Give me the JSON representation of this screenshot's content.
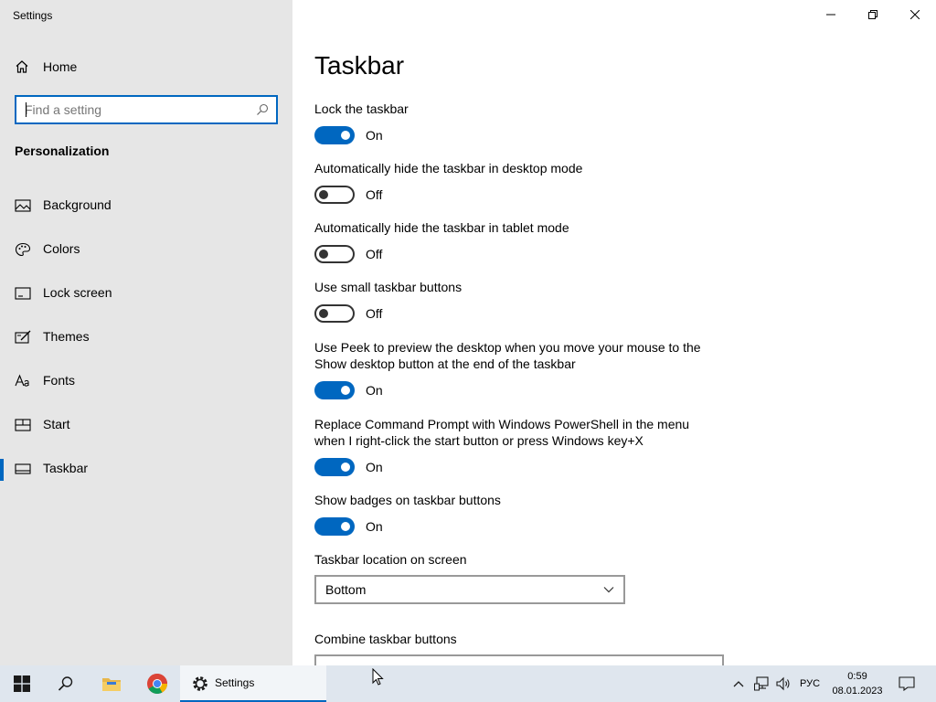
{
  "window": {
    "title": "Settings",
    "minimize_glyph": "—",
    "restore_glyph": "❐",
    "close_glyph": "✕"
  },
  "sidebar": {
    "home_label": "Home",
    "search_placeholder": "Find a setting",
    "section_title": "Personalization",
    "items": [
      {
        "label": "Background",
        "icon": "image-icon"
      },
      {
        "label": "Colors",
        "icon": "palette-icon"
      },
      {
        "label": "Lock screen",
        "icon": "lock-screen-icon"
      },
      {
        "label": "Themes",
        "icon": "themes-icon"
      },
      {
        "label": "Fonts",
        "icon": "fonts-icon"
      },
      {
        "label": "Start",
        "icon": "start-icon"
      },
      {
        "label": "Taskbar",
        "icon": "taskbar-icon",
        "active": true
      }
    ]
  },
  "main": {
    "title": "Taskbar",
    "settings": [
      {
        "description": "Lock the taskbar",
        "state": "On"
      },
      {
        "description": "Automatically hide the taskbar in desktop mode",
        "state": "Off"
      },
      {
        "description": "Automatically hide the taskbar in tablet mode",
        "state": "Off"
      },
      {
        "description": "Use small taskbar buttons",
        "state": "Off"
      },
      {
        "description": "Use Peek to preview the desktop when you move your mouse to the Show desktop button at the end of the taskbar",
        "state": "On"
      },
      {
        "description": "Replace Command Prompt with Windows PowerShell in the menu when I right-click the start button or press Windows key+X",
        "state": "On"
      },
      {
        "description": "Show badges on taskbar buttons",
        "state": "On"
      }
    ],
    "location": {
      "label": "Taskbar location on screen",
      "value": "Bottom"
    },
    "combine": {
      "label": "Combine taskbar buttons"
    }
  },
  "taskbar": {
    "app_label": "Settings",
    "language": "РУС",
    "time": "0:59",
    "date": "08.01.2023"
  },
  "colors": {
    "accent": "#0067c0",
    "sidebar_bg": "#e6e6e6",
    "taskbar_bg": "#dfe6ee"
  }
}
